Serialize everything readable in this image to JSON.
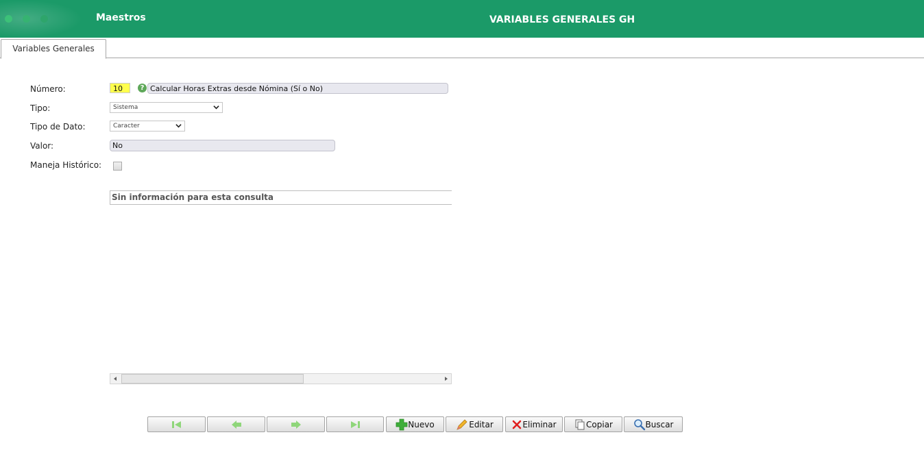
{
  "header": {
    "section": "Maestros",
    "title": "VARIABLES GENERALES GH"
  },
  "tabs": [
    {
      "label": "Variables Generales"
    }
  ],
  "form": {
    "numero": {
      "label": "Número:",
      "value": "10",
      "description": "Calcular Horas Extras desde Nómina (Sí o No)"
    },
    "tipo": {
      "label": "Tipo:",
      "value": "Sistema"
    },
    "tipo_dato": {
      "label": "Tipo de Dato:",
      "value": "Caracter"
    },
    "valor": {
      "label": "Valor:",
      "value": "No"
    },
    "maneja_historico": {
      "label": "Maneja Histórico:",
      "checked": false
    }
  },
  "grid": {
    "empty_message": "Sin información para esta consulta"
  },
  "toolbar": {
    "nuevo": "Nuevo",
    "editar": "Editar",
    "eliminar": "Eliminar",
    "copiar": "Copiar",
    "buscar": "Buscar"
  },
  "colors": {
    "header_bg": "#1b9a68",
    "highlight_input": "#ffff4d",
    "nav_green": "#8fd67a"
  },
  "icons": {
    "first": "first-record-icon",
    "prev": "previous-record-icon",
    "next": "next-record-icon",
    "last": "last-record-icon",
    "nuevo": "plus-icon",
    "editar": "pencil-icon",
    "eliminar": "red-x-icon",
    "copiar": "copy-icon",
    "buscar": "magnifier-icon"
  }
}
